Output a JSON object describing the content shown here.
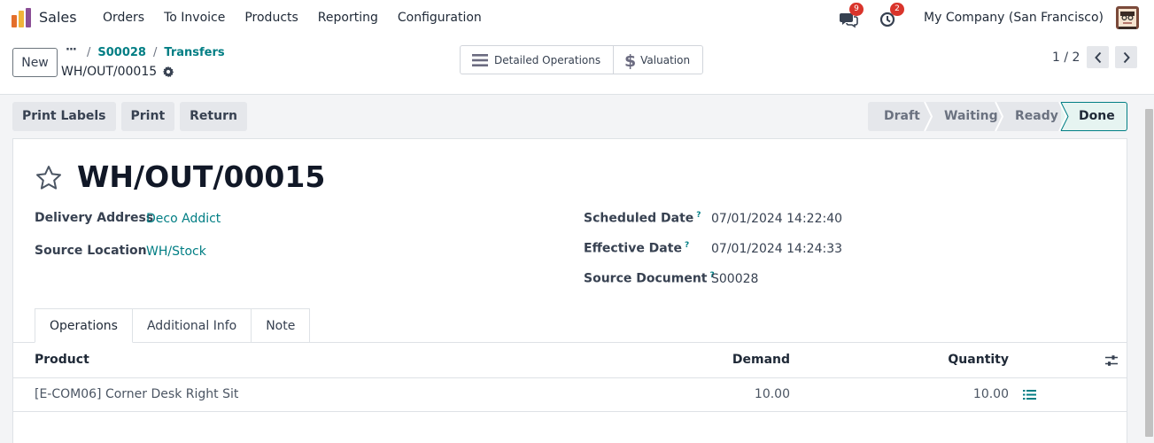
{
  "navbar": {
    "app_name": "Sales",
    "menu": [
      "Orders",
      "To Invoice",
      "Products",
      "Reporting",
      "Configuration"
    ],
    "chat_badge": "9",
    "activity_badge": "2",
    "company": "My Company (San Francisco)"
  },
  "control": {
    "new_label": "New",
    "breadcrumb_dots": "···",
    "breadcrumb": [
      "S00028",
      "Transfers"
    ],
    "breadcrumb_sep": "/",
    "record_name": "WH/OUT/00015",
    "smart_buttons": [
      "Detailed Operations",
      "Valuation"
    ],
    "pager": "1 / 2"
  },
  "actions": [
    "Print Labels",
    "Print",
    "Return"
  ],
  "statusbar": [
    "Draft",
    "Waiting",
    "Ready",
    "Done"
  ],
  "form": {
    "title": "WH/OUT/00015",
    "delivery_address_label": "Delivery Address",
    "delivery_address": "Deco Addict",
    "source_location_label": "Source Location",
    "source_location": "WH/Stock",
    "scheduled_date_label": "Scheduled Date",
    "scheduled_date": "07/01/2024 14:22:40",
    "effective_date_label": "Effective Date",
    "effective_date": "07/01/2024 14:24:33",
    "source_document_label": "Source Document",
    "source_document": "S00028",
    "help_mark": "?"
  },
  "tabs": [
    "Operations",
    "Additional Info",
    "Note"
  ],
  "table": {
    "headers": {
      "product": "Product",
      "demand": "Demand",
      "quantity": "Quantity"
    },
    "rows": [
      {
        "product": "[E-COM06] Corner Desk Right Sit",
        "demand": "10.00",
        "quantity": "10.00"
      }
    ]
  },
  "colors": {
    "accent": "#017e84",
    "badge": "#d9342b",
    "brand_logo": [
      "#e46f2b",
      "#f0b43a",
      "#8b4e96"
    ]
  }
}
